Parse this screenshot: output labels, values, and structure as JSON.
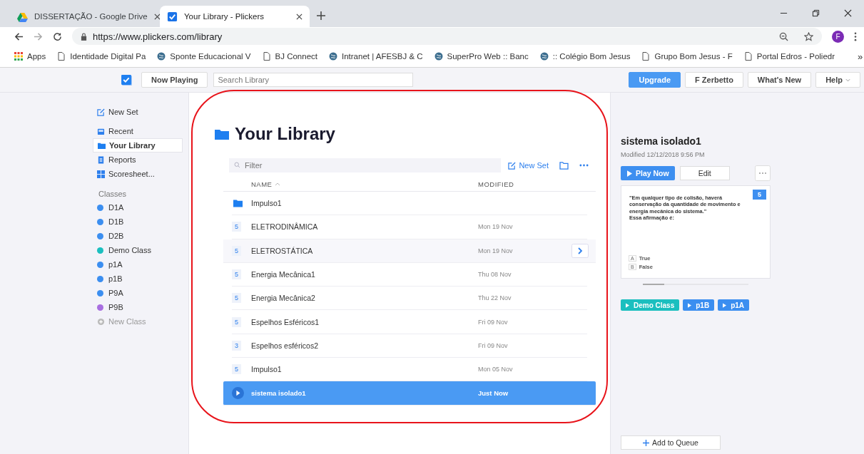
{
  "browser": {
    "tabs": [
      {
        "title": "DISSERTAÇÃO - Google Drive",
        "selected": false
      },
      {
        "title": "Your Library - Plickers",
        "selected": true
      }
    ],
    "url": "https://www.plickers.com/library",
    "profile_initial": "F",
    "bookmarks": [
      "Apps",
      "Identidade Digital Pa",
      "Sponte Educacional V",
      "BJ Connect",
      "Intranet | AFESBJ & C",
      "SuperPro Web :: Banc",
      ":: Colégio Bom Jesus",
      "Grupo Bom Jesus - F",
      "Portal Edros - Poliedr"
    ],
    "more": "»"
  },
  "topbar": {
    "now_playing": "Now Playing",
    "search_placeholder": "Search Library",
    "buttons": [
      {
        "label": "Upgrade",
        "kind": "primary"
      },
      {
        "label": "F Zerbetto",
        "kind": "plain"
      },
      {
        "label": "What's New",
        "kind": "plain"
      },
      {
        "label": "Help",
        "kind": "menu"
      }
    ]
  },
  "sidebar": {
    "new_set": "New Set",
    "items": [
      {
        "label": "Recent",
        "selected": false
      },
      {
        "label": "Your Library",
        "selected": true
      },
      {
        "label": "Reports",
        "selected": false
      },
      {
        "label": "Scoresheet...",
        "selected": false
      }
    ],
    "classes_heading": "Classes",
    "classes": [
      {
        "label": "D1A",
        "color": "#3b8ef0"
      },
      {
        "label": "D1B",
        "color": "#3b8ef0"
      },
      {
        "label": "D2B",
        "color": "#3b8ef0"
      },
      {
        "label": "Demo Class",
        "color": "#1bbfbf"
      },
      {
        "label": "p1A",
        "color": "#3b8ef0"
      },
      {
        "label": "p1B",
        "color": "#3b8ef0"
      },
      {
        "label": "P9A",
        "color": "#3b8ef0"
      },
      {
        "label": "P9B",
        "color": "#a86ee0"
      }
    ],
    "new_class": "New Class"
  },
  "library": {
    "title": "Your Library",
    "filter_placeholder": "Filter",
    "new_set": "New Set",
    "columns": [
      "NAME",
      "MODIFIED"
    ],
    "rows": [
      {
        "kind": "folder",
        "name": "Impulso1",
        "selected": false,
        "hovered": false
      },
      {
        "kind": "set",
        "count": "5",
        "name": "ELETRODINÂMICA",
        "modified": "Mon 19 Nov",
        "selected": false,
        "hovered": false
      },
      {
        "kind": "set",
        "count": "5",
        "name": "ELETROSTÁTICA",
        "modified": "Mon 19 Nov",
        "selected": false,
        "hovered": true
      },
      {
        "kind": "set",
        "count": "5",
        "name": "Energia Mecânica1",
        "modified": "Thu 08 Nov",
        "selected": false,
        "hovered": false
      },
      {
        "kind": "set",
        "count": "5",
        "name": "Energia Mecânica2",
        "modified": "Thu 22 Nov",
        "selected": false,
        "hovered": false
      },
      {
        "kind": "set",
        "count": "5",
        "name": "Espelhos Esféricos1",
        "modified": "Fri 09 Nov",
        "selected": false,
        "hovered": false
      },
      {
        "kind": "set",
        "count": "3",
        "name": "Espelhos esféricos2",
        "modified": "Fri 09 Nov",
        "selected": false,
        "hovered": false
      },
      {
        "kind": "set",
        "count": "5",
        "name": "Impulso1",
        "modified": "Mon 05 Nov",
        "selected": false,
        "hovered": false
      },
      {
        "kind": "set",
        "name": "sistema isolado1",
        "modified": "Just Now",
        "selected": true,
        "hovered": false
      }
    ]
  },
  "detail": {
    "title": "sistema isolado1",
    "modified": "Modified 12/12/2018 9:56 PM",
    "play": "Play Now",
    "edit": "Edit",
    "preview": {
      "count": "5",
      "question": [
        "\"Em qualquer tipo de colisão, haverá conservação da quantidade de movimento e energia mecânica do sistema.\"",
        "Essa afirmação é:"
      ],
      "choices": [
        {
          "letter": "A",
          "text": "True"
        },
        {
          "letter": "B",
          "text": "False"
        }
      ]
    },
    "classes": [
      {
        "label": "Demo Class",
        "color": "#1bbfbf"
      },
      {
        "label": "p1B",
        "color": "#3b8ef0"
      },
      {
        "label": "p1A",
        "color": "#3b8ef0"
      }
    ],
    "add_to_queue": "Add to Queue"
  }
}
